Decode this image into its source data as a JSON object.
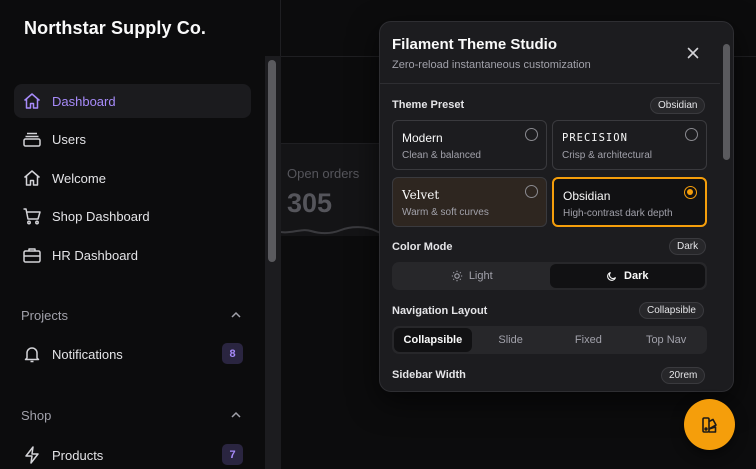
{
  "app": {
    "brand": "Northstar Supply Co."
  },
  "sidebar": {
    "items": [
      {
        "label": "Dashboard",
        "icon": "home-icon",
        "active": true
      },
      {
        "label": "Users",
        "icon": "stack-icon"
      },
      {
        "label": "Welcome",
        "icon": "home-icon"
      },
      {
        "label": "Shop Dashboard",
        "icon": "cart-icon"
      },
      {
        "label": "HR Dashboard",
        "icon": "briefcase-icon"
      }
    ],
    "groups": [
      {
        "label": "Projects",
        "items": [
          {
            "label": "Notifications",
            "icon": "bell-icon",
            "badge": "8"
          }
        ]
      },
      {
        "label": "Shop",
        "items": [
          {
            "label": "Products",
            "icon": "bolt-icon",
            "badge": "7"
          }
        ]
      }
    ]
  },
  "main": {
    "stat": {
      "label": "Open orders",
      "value": "305"
    }
  },
  "theme_panel": {
    "title": "Filament Theme Studio",
    "subtitle": "Zero-reload instantaneous customization",
    "preset": {
      "label": "Theme Preset",
      "selected": "Obsidian",
      "options": [
        {
          "name": "Modern",
          "desc": "Clean & balanced"
        },
        {
          "name": "PRECISION",
          "desc": "Crisp & architectural"
        },
        {
          "name": "Velvet",
          "desc": "Warm & soft curves"
        },
        {
          "name": "Obsidian",
          "desc": "High-contrast dark depth"
        }
      ]
    },
    "color_mode": {
      "label": "Color Mode",
      "selected": "Dark",
      "options": [
        "Light",
        "Dark"
      ]
    },
    "nav_layout": {
      "label": "Navigation Layout",
      "selected": "Collapsible",
      "options": [
        "Collapsible",
        "Slide",
        "Fixed",
        "Top Nav"
      ]
    },
    "sidebar_width": {
      "label": "Sidebar Width",
      "value": "20rem"
    }
  },
  "colors": {
    "accent": "#f59e0b",
    "active_nav": "#a78bfa",
    "background": "#0c0c0d",
    "panel": "#1c1c1f"
  }
}
